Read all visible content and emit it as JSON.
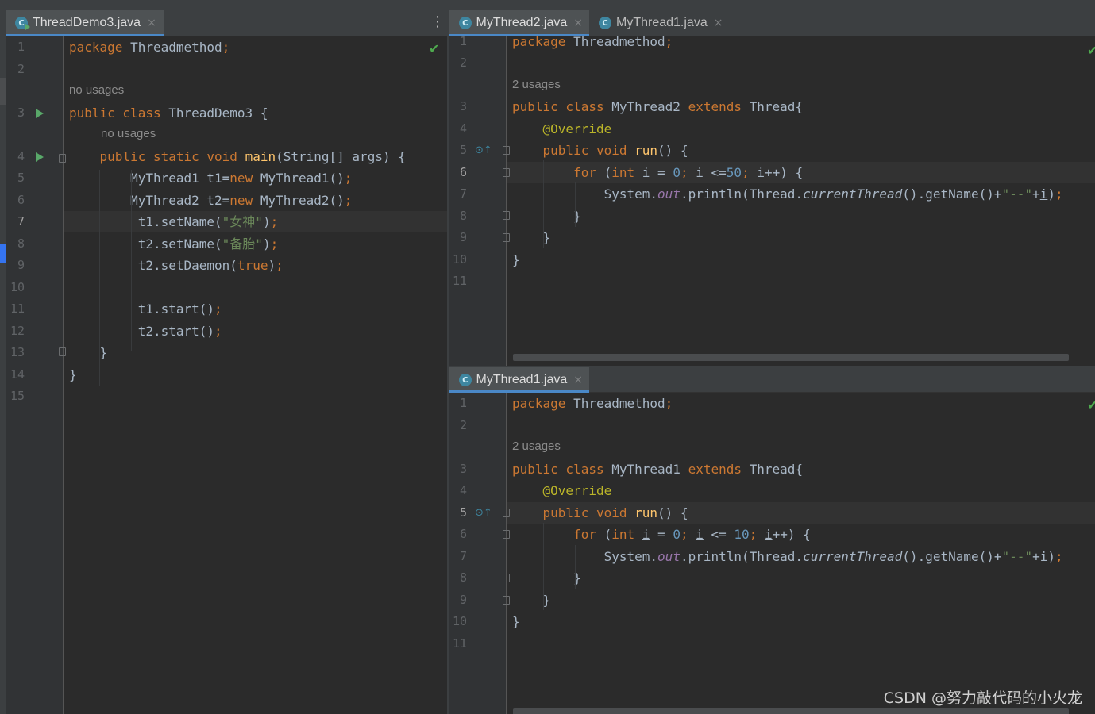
{
  "left_pane": {
    "tab_label": "ThreadDemo3.java",
    "code": [
      {
        "ln": "1",
        "hint": "",
        "html": "<span class=\"kw\">package</span> Threadmethod<span class=\"kw\">;</span>"
      },
      {
        "ln": "2"
      },
      {
        "ln": "3",
        "hint": "no usages",
        "html": "<span class=\"kw\">public class</span> ThreadDemo3 {"
      },
      {
        "ln": "4",
        "hint": "no usages",
        "html": "    <span class=\"kw\">public static void</span> <span class=\"fn\">main</span>(String[] args) {"
      },
      {
        "ln": "5",
        "html": "        MyThread1 t1=<span class=\"kw\">new</span> MyThread1()<span class=\"kw\">;</span>"
      },
      {
        "ln": "6",
        "html": "        MyThread2 t2=<span class=\"kw\">new</span> MyThread2()<span class=\"kw\">;</span>"
      },
      {
        "ln": "7",
        "html": "         t1.setName(<span class=\"str\">\"女神\"</span>)<span class=\"kw\">;</span>"
      },
      {
        "ln": "8",
        "html": "         t2.setName(<span class=\"str\">\"备胎\"</span>)<span class=\"kw\">;</span>"
      },
      {
        "ln": "9",
        "html": "         t2.setDaemon(<span class=\"kw\">true</span>)<span class=\"kw\">;</span>"
      },
      {
        "ln": "10"
      },
      {
        "ln": "11",
        "html": "         t1.start()<span class=\"kw\">;</span>"
      },
      {
        "ln": "12",
        "html": "         t2.start()<span class=\"kw\">;</span>"
      },
      {
        "ln": "13",
        "html": "    }"
      },
      {
        "ln": "14",
        "html": "}"
      },
      {
        "ln": "15"
      }
    ]
  },
  "top_right_pane": {
    "tabs": [
      "MyThread2.java",
      "MyThread1.java"
    ],
    "code": [
      {
        "ln": "1",
        "html": "<span class=\"kw\">package</span> Threadmethod<span class=\"kw\">;</span>"
      },
      {
        "ln": "2"
      },
      {
        "ln": "3",
        "hint": "2 usages",
        "html": "<span class=\"kw\">public class</span> MyThread2 <span class=\"kw\">extends</span> Thread{"
      },
      {
        "ln": "4",
        "html": "    <span class=\"ann\">@Override</span>"
      },
      {
        "ln": "5",
        "html": "    <span class=\"kw\">public void</span> <span class=\"fn\">run</span>() {"
      },
      {
        "ln": "6",
        "html": "        <span class=\"kw\">for</span> (<span class=\"kw\">int</span> <span class=\"ul\">i</span> = <span class=\"num\">0</span><span class=\"kw\">;</span> <span class=\"ul\">i</span> &lt;=<span class=\"num\">50</span><span class=\"kw\">;</span> <span class=\"ul\">i</span>++) {"
      },
      {
        "ln": "7",
        "html": "            System.<span class=\"fld\">out</span>.println(Thread.<span class=\"ital\">currentThread</span>().getName()+<span class=\"str\">\"--\"</span>+<span class=\"ul\">i</span>)<span class=\"kw\">;</span>"
      },
      {
        "ln": "8",
        "html": "        }"
      },
      {
        "ln": "9",
        "html": "    }"
      },
      {
        "ln": "10",
        "html": "}"
      },
      {
        "ln": "11"
      }
    ]
  },
  "bottom_right_pane": {
    "tab_label": "MyThread1.java",
    "code": [
      {
        "ln": "1",
        "html": "<span class=\"kw\">package</span> Threadmethod<span class=\"kw\">;</span>"
      },
      {
        "ln": "2"
      },
      {
        "ln": "3",
        "hint": "2 usages",
        "html": "<span class=\"kw\">public class</span> MyThread1 <span class=\"kw\">extends</span> Thread{"
      },
      {
        "ln": "4",
        "html": "    <span class=\"ann\">@Override</span>"
      },
      {
        "ln": "5",
        "html": "    <span class=\"kw\">public void</span> <span class=\"fn\">run</span>() {"
      },
      {
        "ln": "6",
        "html": "        <span class=\"kw\">for</span> (<span class=\"kw\">int</span> <span class=\"ul\">i</span> = <span class=\"num\">0</span><span class=\"kw\">;</span> <span class=\"ul\">i</span> &lt;= <span class=\"num\">10</span><span class=\"kw\">;</span> <span class=\"ul\">i</span>++) {"
      },
      {
        "ln": "7",
        "html": "            System.<span class=\"fld\">out</span>.println(Thread.<span class=\"ital\">currentThread</span>().getName()+<span class=\"str\">\"--\"</span>+<span class=\"ul\">i</span>)<span class=\"kw\">;</span>"
      },
      {
        "ln": "8",
        "html": "        }"
      },
      {
        "ln": "9",
        "html": "    }"
      },
      {
        "ln": "10",
        "html": "}"
      },
      {
        "ln": "11"
      }
    ]
  },
  "watermark": "CSDN @努力敲代码的小火龙",
  "icons": {
    "tab_close": "×",
    "menu": "⋮",
    "check": "✔"
  }
}
